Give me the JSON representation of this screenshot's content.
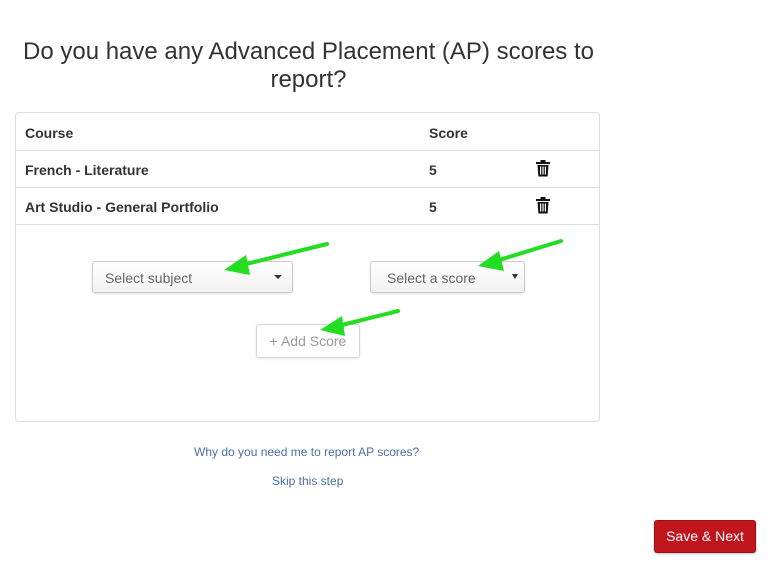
{
  "heading": "Do you have any Advanced Placement (AP) scores to report?",
  "table": {
    "headers": {
      "course": "Course",
      "score": "Score"
    },
    "rows": [
      {
        "course": "French - Literature",
        "score": "5"
      },
      {
        "course": "Art Studio - General Portfolio",
        "score": "5"
      }
    ]
  },
  "form": {
    "subject_select": "Select subject",
    "score_select": "Select a score",
    "add_button": "+ Add Score"
  },
  "links": {
    "why": "Why do you need me to report AP scores?",
    "skip": "Skip this step"
  },
  "save_button": "Save & Next",
  "colors": {
    "save_button_bg": "#c0151c",
    "link": "#4a6ea3",
    "annotation_arrow": "#22dd22"
  },
  "icons": {
    "delete": "trash-icon",
    "dropdown": "caret-down-icon",
    "annotation": "arrow-annotation"
  }
}
